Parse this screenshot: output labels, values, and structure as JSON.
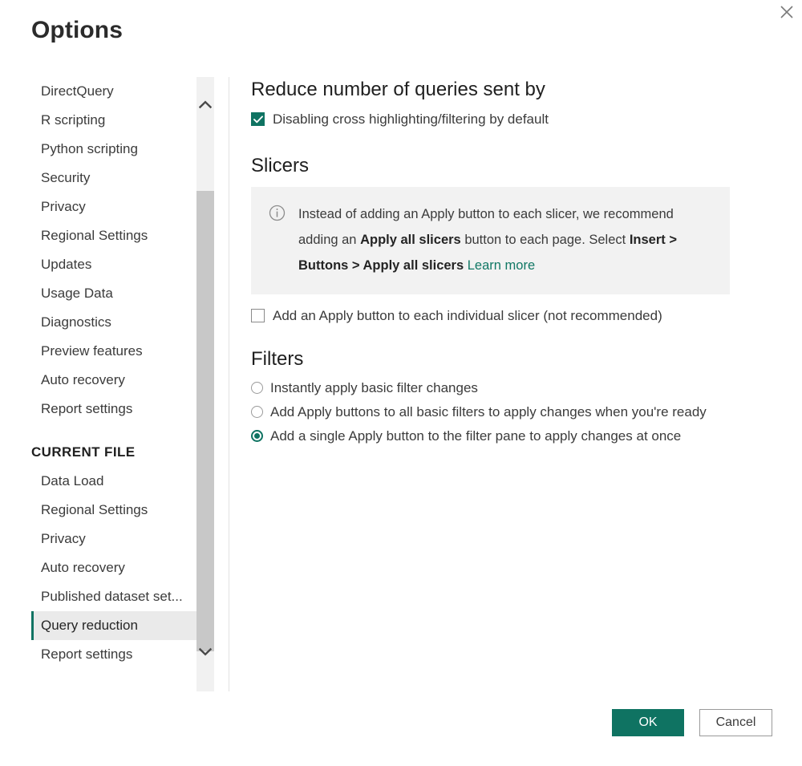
{
  "dialog": {
    "title": "Options",
    "close_label": "✕"
  },
  "sidebar": {
    "global_items": [
      {
        "label": "DirectQuery",
        "selected": false
      },
      {
        "label": "R scripting",
        "selected": false
      },
      {
        "label": "Python scripting",
        "selected": false
      },
      {
        "label": "Security",
        "selected": false
      },
      {
        "label": "Privacy",
        "selected": false
      },
      {
        "label": "Regional Settings",
        "selected": false
      },
      {
        "label": "Updates",
        "selected": false
      },
      {
        "label": "Usage Data",
        "selected": false
      },
      {
        "label": "Diagnostics",
        "selected": false
      },
      {
        "label": "Preview features",
        "selected": false
      },
      {
        "label": "Auto recovery",
        "selected": false
      },
      {
        "label": "Report settings",
        "selected": false
      }
    ],
    "section_header": "CURRENT FILE",
    "current_file_items": [
      {
        "label": "Data Load",
        "selected": false
      },
      {
        "label": "Regional Settings",
        "selected": false
      },
      {
        "label": "Privacy",
        "selected": false
      },
      {
        "label": "Auto recovery",
        "selected": false
      },
      {
        "label": "Published dataset set...",
        "selected": false
      },
      {
        "label": "Query reduction",
        "selected": true
      },
      {
        "label": "Report settings",
        "selected": false
      }
    ],
    "scrollbar": {
      "up_arrow": "chevron-up",
      "down_arrow": "chevron-down"
    }
  },
  "content": {
    "reduce_queries": {
      "heading": "Reduce number of queries sent by",
      "checkbox": {
        "label": "Disabling cross highlighting/filtering by default",
        "checked": true
      }
    },
    "slicers": {
      "heading": "Slicers",
      "info": {
        "icon": "info-icon",
        "text_part_1": "Instead of adding an Apply button to each slicer, we recommend adding an ",
        "bold_1": "Apply all slicers",
        "text_part_2": " button to each page. Select ",
        "bold_2": "Insert > Buttons > Apply all slicers",
        "link": "Learn more"
      },
      "checkbox": {
        "label": "Add an Apply button to each individual slicer (not recommended)",
        "checked": false
      }
    },
    "filters": {
      "heading": "Filters",
      "options": [
        {
          "label": "Instantly apply basic filter changes",
          "selected": false
        },
        {
          "label": "Add Apply buttons to all basic filters to apply changes when you're ready",
          "selected": false
        },
        {
          "label": "Add a single Apply button to the filter pane to apply changes at once",
          "selected": true
        }
      ]
    }
  },
  "footer": {
    "ok_label": "OK",
    "cancel_label": "Cancel"
  },
  "colors": {
    "accent": "#0f7362",
    "link": "#117865",
    "selected_row_bg": "#eaeaea",
    "info_box_bg": "#f2f2f2"
  }
}
